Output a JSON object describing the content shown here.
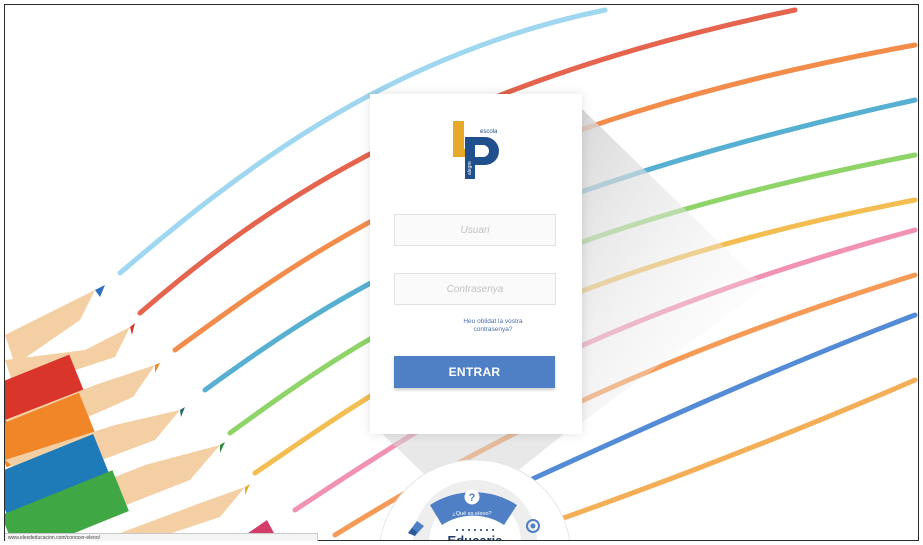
{
  "login": {
    "username_placeholder": "Usuari",
    "password_placeholder": "Contrasenya",
    "forgot_password": "Heu oblidat la vostra contrasenya?",
    "submit_label": "ENTRAR"
  },
  "logo": {
    "letters": "JP",
    "text_top": "escola",
    "text_side": "alegre"
  },
  "dial": {
    "help_label": "¿Qué es eleoo?",
    "brand": "Educaria"
  },
  "status_bar": {
    "url": "www.elesdeducacion.com/conocer-eleoo/"
  },
  "colors": {
    "button": "#4f7fc4",
    "logo_blue": "#1f4f8c",
    "logo_gold": "#e6a92a",
    "brand_navy": "#1f3a66"
  }
}
